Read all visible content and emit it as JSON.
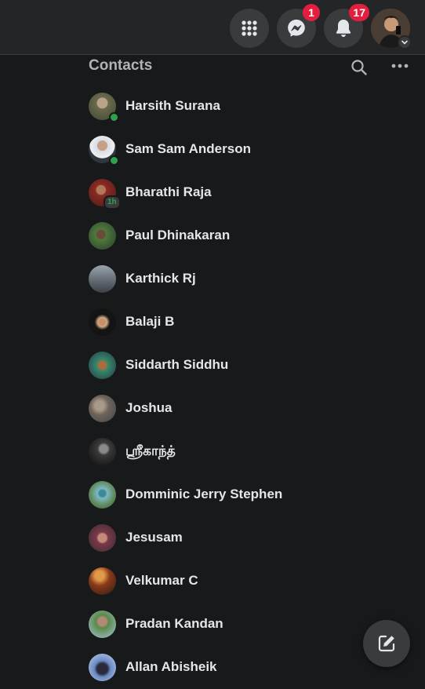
{
  "header": {
    "menu_icon": "grid-menu-icon",
    "messenger_icon": "messenger-icon",
    "messenger_badge": "1",
    "notifications_icon": "bell-icon",
    "notifications_badge": "17",
    "profile_icon": "profile-avatar",
    "caret_icon": "chevron-down-icon"
  },
  "contacts": {
    "title": "Contacts",
    "search_icon": "search-icon",
    "more_icon": "more-options-icon",
    "items": [
      {
        "name": "Harsith Surana",
        "status": "online"
      },
      {
        "name": "Sam Sam Anderson",
        "status": "online"
      },
      {
        "name": "Bharathi Raja",
        "status": "1h"
      },
      {
        "name": "Paul Dhinakaran",
        "status": ""
      },
      {
        "name": "Karthick Rj",
        "status": ""
      },
      {
        "name": "Balaji B",
        "status": ""
      },
      {
        "name": "Siddarth Siddhu",
        "status": ""
      },
      {
        "name": "Joshua",
        "status": ""
      },
      {
        "name": "ஸ்ரீகாந்த்",
        "status": ""
      },
      {
        "name": "Domminic Jerry Stephen",
        "status": ""
      },
      {
        "name": "Jesusam",
        "status": ""
      },
      {
        "name": "Velkumar C",
        "status": ""
      },
      {
        "name": "Pradan Kandan",
        "status": ""
      },
      {
        "name": "Allan Abisheik",
        "status": ""
      }
    ]
  },
  "fab": {
    "icon": "new-message-icon"
  },
  "colors": {
    "background": "#18191a",
    "topbar": "#242526",
    "button": "#3a3b3c",
    "badge": "#e41e3f",
    "online": "#31a24c",
    "text": "#e4e6eb",
    "secondary_text": "#b0b3b8"
  }
}
